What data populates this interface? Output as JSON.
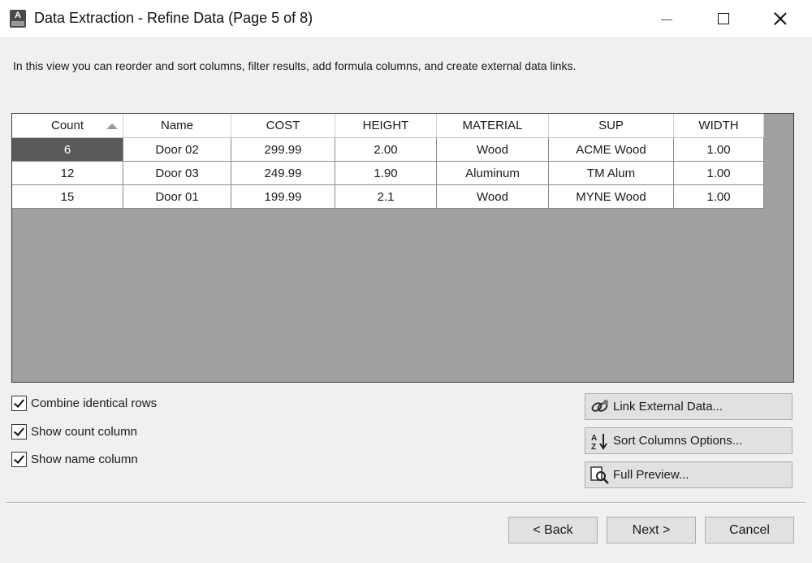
{
  "window": {
    "title": "Data Extraction - Refine Data (Page 5 of 8)",
    "icon": "autocad-app-icon",
    "icon_letter": "A"
  },
  "description": "In this view you can reorder and sort columns, filter results, add formula columns, and create external data links.",
  "grid": {
    "columns": [
      {
        "label": "Count",
        "sorted": "ascending"
      },
      {
        "label": "Name"
      },
      {
        "label": "COST"
      },
      {
        "label": "HEIGHT"
      },
      {
        "label": "MATERIAL"
      },
      {
        "label": "SUP"
      },
      {
        "label": "WIDTH"
      }
    ],
    "rows": [
      [
        "6",
        "Door 02",
        "299.99",
        "2.00",
        "Wood",
        "ACME Wood",
        "1.00"
      ],
      [
        "12",
        "Door 03",
        "249.99",
        "1.90",
        "Aluminum",
        "TM Alum",
        "1.00"
      ],
      [
        "15",
        "Door 01",
        "199.99",
        "2.1",
        "Wood",
        "MYNE Wood",
        "1.00"
      ]
    ],
    "selected_cell": {
      "row": 0,
      "col": 0
    }
  },
  "options": {
    "combine_identical_rows": {
      "label": "Combine identical rows",
      "checked": true
    },
    "show_count_column": {
      "label": "Show count column",
      "checked": true
    },
    "show_name_column": {
      "label": "Show name column",
      "checked": true
    }
  },
  "side_buttons": {
    "link_external_data": {
      "label": "Link External Data...",
      "icon": "link-icon"
    },
    "sort_columns_options": {
      "label": "Sort Columns Options...",
      "icon": "sort-az-icon"
    },
    "full_preview": {
      "label": "Full Preview...",
      "icon": "preview-magnifier-icon"
    }
  },
  "footer": {
    "back_label": "< Back",
    "next_label": "Next >",
    "cancel_label": "Cancel"
  },
  "colors": {
    "grid_background": "#a0a0a0",
    "selected_cell": "#5a5a5a",
    "dialog_background": "#f0f0f0",
    "button_face": "#e1e1e1"
  }
}
